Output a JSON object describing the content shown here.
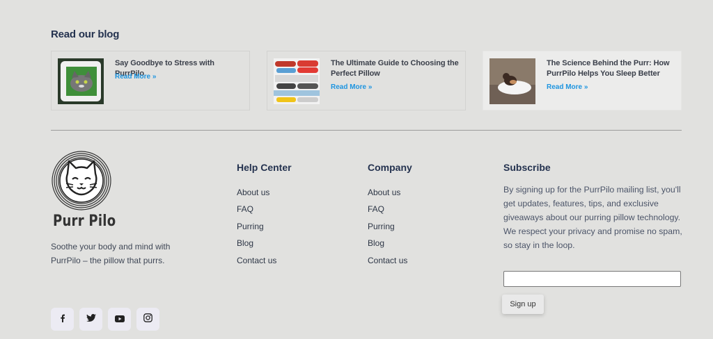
{
  "blog": {
    "heading": "Read our blog",
    "posts": [
      {
        "title": "Say Goodbye to Stress with PurrPilo",
        "read_more": "Read More »"
      },
      {
        "title": "The Ultimate Guide to Choosing the Perfect Pillow",
        "read_more": "Read More »"
      },
      {
        "title": "The Science Behind the Purr: How PurrPilo Helps You Sleep Better",
        "read_more": "Read More »"
      }
    ]
  },
  "brand": {
    "name": "Purr Pilo",
    "tagline": "Soothe your body and mind with PurrPilo – the pillow that purrs."
  },
  "social": [
    "facebook-icon",
    "twitter-icon",
    "youtube-icon",
    "instagram-icon"
  ],
  "help_center": {
    "heading": "Help Center",
    "links": [
      "About us",
      "FAQ",
      "Purring",
      "Blog",
      "Contact us"
    ]
  },
  "company": {
    "heading": "Company",
    "links": [
      "About us",
      "FAQ",
      "Purring",
      "Blog",
      "Contact us"
    ]
  },
  "subscribe": {
    "heading": "Subscribe",
    "text": "By signing up for the PurrPilo mailing list, you'll get updates, features, tips, and exclusive giveaways about our purring pillow technology. We respect your privacy and promise no spam, so stay in the loop.",
    "email_value": "",
    "button_label": "Sign up"
  },
  "colors": {
    "background": "#e1e1df",
    "heading": "#24324f",
    "link_accent": "#1e95e0"
  }
}
